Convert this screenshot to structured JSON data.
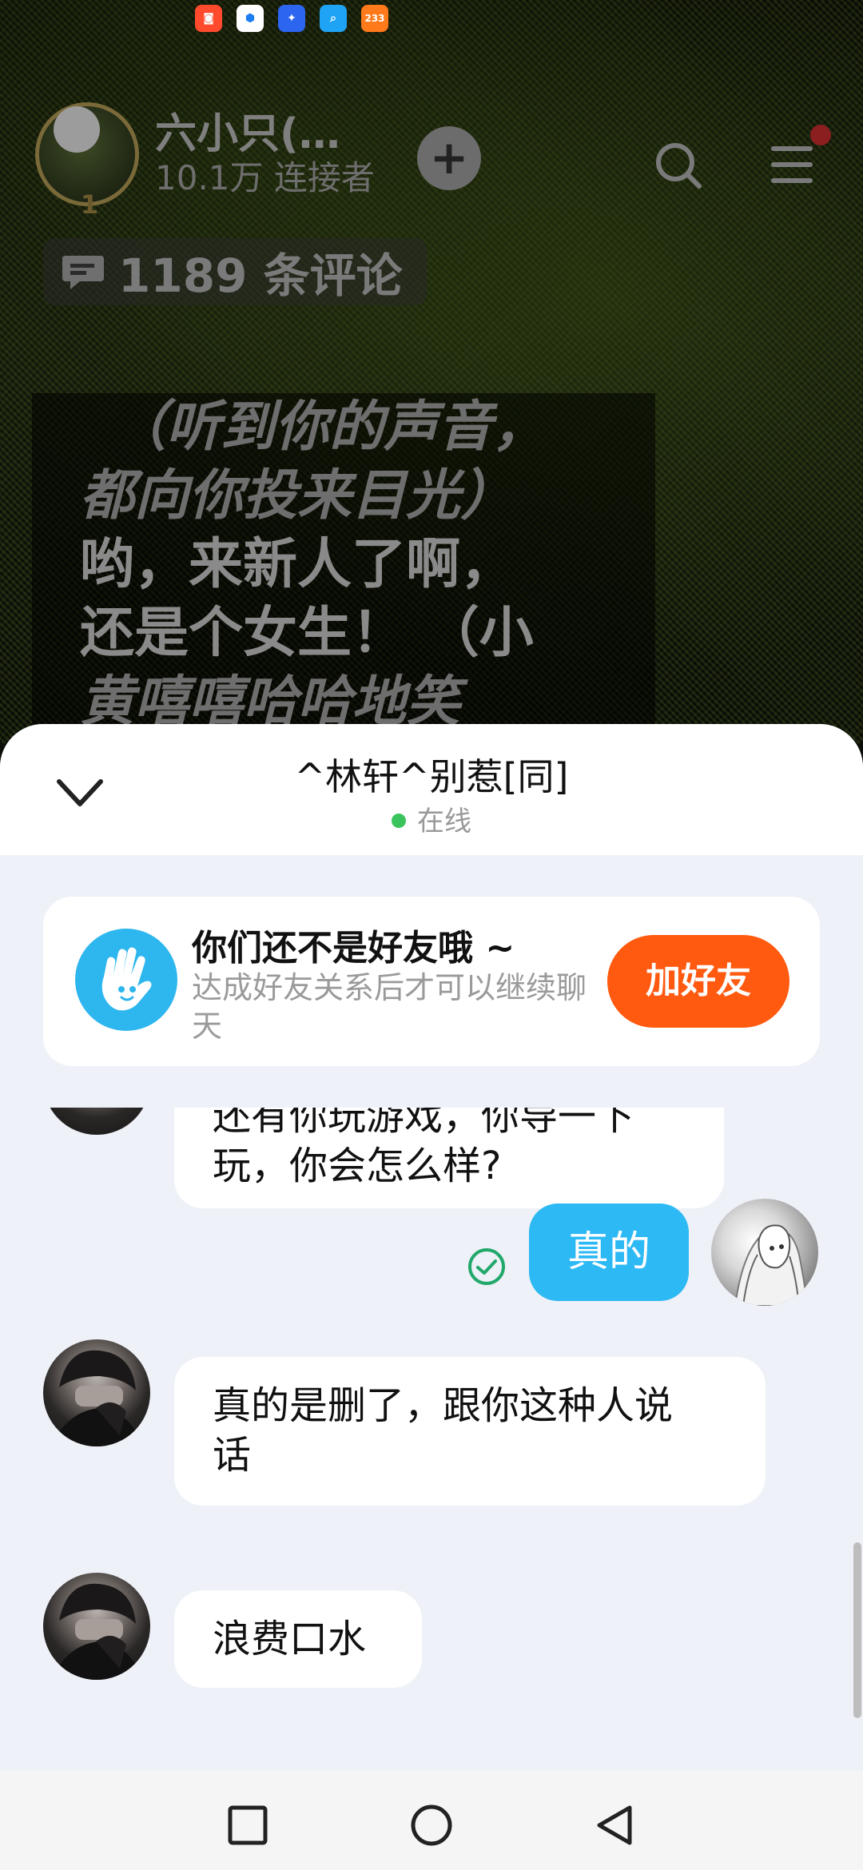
{
  "status_bar": {
    "notification_icons": [
      {
        "name": "kuaishou-app-icon",
        "color": "#ff4a2e",
        "glyph": "◙"
      },
      {
        "name": "shield-app-icon",
        "color": "#ffffff",
        "glyph": "⬢"
      },
      {
        "name": "bulb-app-icon",
        "color": "#2b65f0",
        "glyph": "✦"
      },
      {
        "name": "search-app-icon",
        "color": "#1fa3f5",
        "glyph": "⌕"
      },
      {
        "name": "233-app-icon",
        "color": "#ff7a1a",
        "glyph": "233"
      }
    ]
  },
  "video_page": {
    "author_name": "六小只(…",
    "author_fans": "10.1万 连接者",
    "author_rank": "1",
    "plus_glyph": "+",
    "comment_count": "1189 条评论",
    "caption_lines": [
      {
        "text": "（听到你的声音，",
        "italic": true
      },
      {
        "text": "都向你投来目光）",
        "italic": true
      },
      {
        "text": "哟，来新人了啊，",
        "italic": false
      },
      {
        "text": "还是个女生！ （小",
        "italic": false
      },
      {
        "text": "黄嘻嘻哈哈地笑",
        "italic": true
      }
    ]
  },
  "chat": {
    "peer_name": "^林轩^别惹[同]",
    "status": "在线",
    "status_color": "#3bc45d",
    "friend_card": {
      "title": "你们还不是好友哦 ~",
      "subtitle": "达成好友关系后才可以继续聊天",
      "button_label": "加好友",
      "button_color": "#ff5a10"
    },
    "messages": [
      {
        "from": "peer",
        "text_lines": [
          "还有你玩游戏，你导一下",
          "玩，你会怎么样?"
        ]
      },
      {
        "from": "me",
        "text": "真的",
        "read": true
      },
      {
        "from": "peer",
        "text_lines": [
          "真的是删了，跟你这种人说",
          "话"
        ]
      },
      {
        "from": "peer",
        "text_lines": [
          "浪费口水"
        ]
      }
    ]
  },
  "nav_bar": {
    "buttons": [
      "recent-apps",
      "home",
      "back"
    ]
  }
}
